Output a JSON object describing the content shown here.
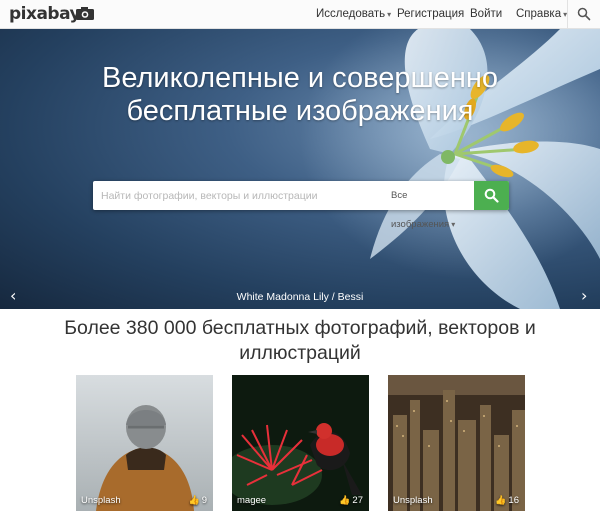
{
  "nav": {
    "logo": "pixabay",
    "items": [
      {
        "label": "Исследовать",
        "caret": "▾"
      },
      {
        "label": "Регистрация"
      },
      {
        "label": "Войти"
      },
      {
        "label": "Справка",
        "caret": "▾"
      }
    ],
    "search_icon": "search-icon"
  },
  "hero": {
    "title_line1": "Великолепные и совершенно",
    "title_line2": "бесплатные изображения",
    "search": {
      "placeholder": "Найти фотографии, векторы и иллюстрации",
      "value": "",
      "type_label": "Все изображения",
      "type_caret": "▾"
    },
    "caption": "White Madonna Lily / Bessi",
    "prev_arrow": "‹",
    "next_arrow": "›"
  },
  "section": {
    "title": "Более 380 000 бесплатных фотографий, векторов и иллюстраций"
  },
  "tiles": [
    {
      "author": "Unsplash",
      "likes": "9",
      "thumb_icon": "👍"
    },
    {
      "author": "magee",
      "likes": "27",
      "thumb_icon": "👍"
    },
    {
      "author": "Unsplash",
      "likes": "16",
      "thumb_icon": "👍"
    }
  ],
  "colors": {
    "accent": "#4caf50",
    "nav_bg": "#fbfbfb",
    "text": "#333333"
  }
}
